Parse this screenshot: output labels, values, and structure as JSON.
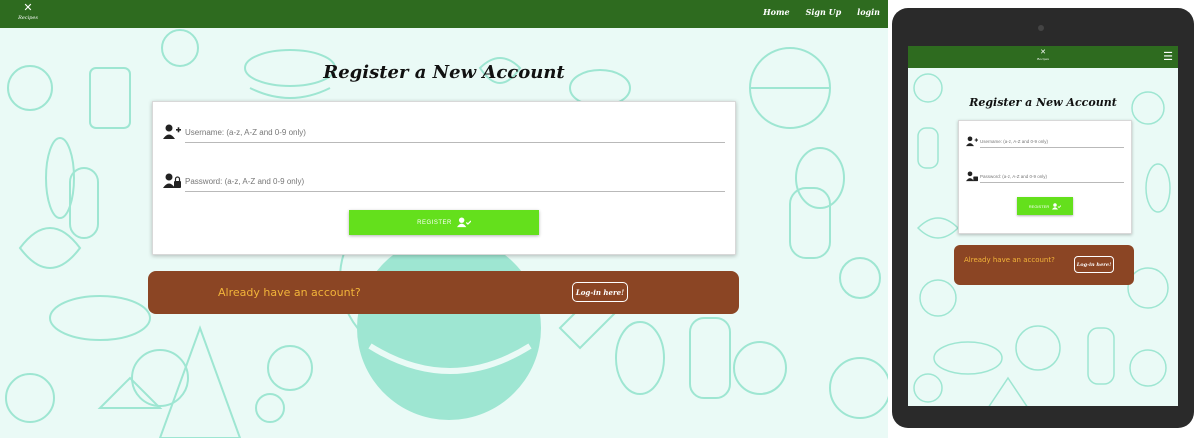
{
  "brand": {
    "name": "Recipes",
    "icon": "fork-knife-icon"
  },
  "nav": {
    "items": [
      {
        "label": "Home"
      },
      {
        "label": "Sign Up"
      },
      {
        "label": "login"
      }
    ]
  },
  "page": {
    "title": "Register a New Account"
  },
  "form": {
    "username_placeholder": "Username: (a-z, A-Z and 0-9 only)",
    "password_placeholder": "Password: (a-z, A-Z and 0-9 only)",
    "register_label": "REGISTER"
  },
  "login_prompt": {
    "text": "Already have an account?",
    "button_label": "Log-in here!"
  },
  "colors": {
    "navbar": "#2e6b1f",
    "register_button": "#64e01c",
    "banner": "#8b4524",
    "banner_text": "#f2b43a",
    "background": "#eafaf6",
    "doodle": "#9ee6d2"
  }
}
